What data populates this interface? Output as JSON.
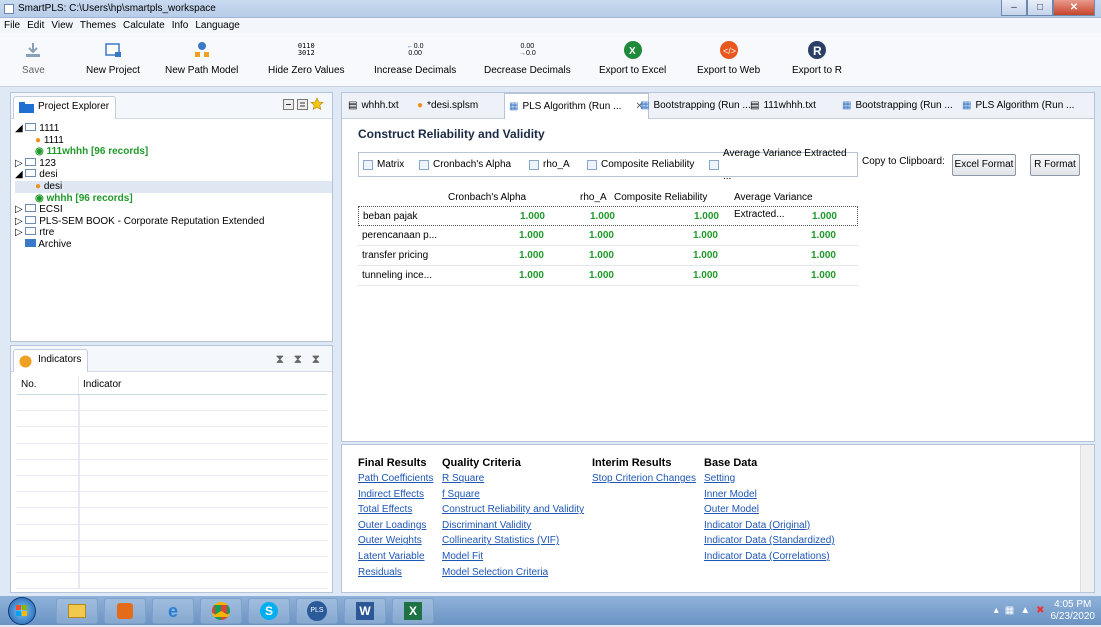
{
  "window": {
    "title": "SmartPLS: C:\\Users\\hp\\smartpls_workspace"
  },
  "menu": [
    "File",
    "Edit",
    "View",
    "Themes",
    "Calculate",
    "Info",
    "Language"
  ],
  "toolbar": {
    "save": "Save",
    "new_project": "New Project",
    "new_path_model": "New Path Model",
    "hide_zero_values": "Hide Zero Values",
    "increase_decimals": "Increase Decimals",
    "decrease_decimals": "Decrease Decimals",
    "export_excel": "Export to Excel",
    "export_web": "Export to Web",
    "export_r": "Export to R",
    "hide_zero_icon_text": "0110\n3012",
    "inc_icon_text": "0.0",
    "dec_icon_text": "0.00"
  },
  "project_explorer": {
    "title": "Project Explorer",
    "items": [
      "1111",
      "1111",
      "111whhh [96 records]",
      "123",
      "desi",
      "desi",
      "whhh [96 records]",
      "ECSI",
      "PLS-SEM BOOK - Corporate Reputation Extended",
      "rtre",
      "Archive"
    ]
  },
  "indicators": {
    "title": "Indicators",
    "col_no": "No.",
    "col_indicator": "Indicator"
  },
  "editor_tabs": [
    "whhh.txt",
    "*desi.splsm",
    "PLS Algorithm (Run ...",
    "Bootstrapping (Run ...",
    "111whhh.txt",
    "Bootstrapping (Run ...",
    "PLS Algorithm (Run ..."
  ],
  "report": {
    "title": "Construct Reliability and Validity",
    "subtabs": [
      "Matrix",
      "Cronbach's Alpha",
      "rho_A",
      "Composite Reliability",
      "Average Variance Extracted ..."
    ],
    "copy_label": "Copy to Clipboard:",
    "excel_btn": "Excel Format",
    "r_btn": "R Format",
    "columns": [
      "Cronbach's Alpha",
      "rho_A",
      "Composite Reliability",
      "Average Variance Extracted..."
    ],
    "rows": [
      {
        "name": "beban pajak",
        "ca": "1.000",
        "rho": "1.000",
        "cr": "1.000",
        "ave": "1.000"
      },
      {
        "name": "perencanaan p...",
        "ca": "1.000",
        "rho": "1.000",
        "cr": "1.000",
        "ave": "1.000"
      },
      {
        "name": "transfer pricing",
        "ca": "1.000",
        "rho": "1.000",
        "cr": "1.000",
        "ave": "1.000"
      },
      {
        "name": "tunneling ince...",
        "ca": "1.000",
        "rho": "1.000",
        "cr": "1.000",
        "ave": "1.000"
      }
    ]
  },
  "nav": {
    "final_results": {
      "header": "Final Results",
      "links": [
        "Path Coefficients",
        "Indirect Effects",
        "Total Effects",
        "Outer Loadings",
        "Outer Weights",
        "Latent Variable",
        "Residuals"
      ]
    },
    "quality_criteria": {
      "header": "Quality Criteria",
      "links": [
        "R Square",
        "f Square",
        "Construct Reliability and Validity",
        "Discriminant Validity",
        "Collinearity Statistics (VIF)",
        "Model Fit",
        "Model Selection Criteria"
      ]
    },
    "interim_results": {
      "header": "Interim Results",
      "links": [
        "Stop Criterion Changes"
      ]
    },
    "base_data": {
      "header": "Base Data",
      "links": [
        "Setting",
        "Inner Model",
        "Outer Model",
        "Indicator Data (Original)",
        "Indicator Data (Standardized)",
        "Indicator Data (Correlations)"
      ]
    }
  },
  "taskbar": {
    "time": "4:05 PM",
    "date": "6/23/2020",
    "pls_icon_text": "PLS"
  }
}
